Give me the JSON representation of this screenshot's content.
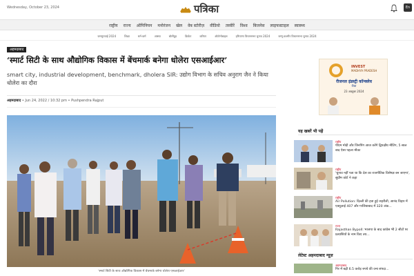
{
  "header": {
    "date": "Wednesday, October 23, 2024",
    "logo": "पत्रिका",
    "lang_label": "En"
  },
  "nav": {
    "items": [
      "राष्ट्रीय",
      "राज्य",
      "ऑपिनियन",
      "मनोरंजन",
      "खेल",
      "वेब स्टोरीज़",
      "वीडियो",
      "तस्वीरें",
      "विश्व",
      "बिजनेस",
      "लाइफस्टाइल",
      "स्वास्थ्य"
    ]
  },
  "subnav": {
    "items": [
      "जनसुनवाई 2024",
      "शिक्षा",
      "धर्म-कर्म",
      "आस्था",
      "बॉलीवुड",
      "क्रिकेट",
      "करियर",
      "ऑटोमोबाइल",
      "हरियाणा विधानसभा चुनाव 2024",
      "जम्मू-कश्मीर विधानसभा चुनाव 2024"
    ]
  },
  "article": {
    "tag": "अहमदाबाद",
    "headline": "‘स्मार्ट सिटी के साथ औद्योगिक विकास में बेंचमार्क बनेगा धोलेरा एसआईआर’",
    "subhead": "smart city, industrial development, benchmark, dholera SIR: उद्योग विभाग के सचिव अनुराग जैन ने किया धोलेरा का दौरा",
    "byline_city": "अहमदाबाद",
    "byline_rest": " • Jun 24, 2022 / 10:32 pm • Pushpendra Rajput",
    "caption": "‘स्मार्ट सिटी के साथ औद्योगिक विकास में बेंचमार्क बनेगा धोलेरा एसआईआर’"
  },
  "ad": {
    "line1": "INVEST",
    "line2": "MADHYA PRADESH",
    "line3": "रीजनल इंडस्ट्री कॉन्क्लेव",
    "line4": "रीवा",
    "line5": "23 अक्टूबर 2024"
  },
  "sidebar": {
    "heading": "यह खबरें भी पढ़ें",
    "heading2": "लेटेस्ट अहमदाबाद न्यूज़",
    "items": [
      {
        "cat": "राष्ट्रीय",
        "title": "पीएम मोदी और जिनपिंग आज करेंगे द्विपक्षीय मीटिंग, 5 साल बाद ऐसा पहला मौका"
      },
      {
        "cat": "राष्ट्रीय",
        "title": "'चुनाव नहीं पता था कि देश का राजनीतिक विशेषज्ञ बन जाएगा', सुप्रीम कोर्ट ने कहा"
      },
      {
        "cat": "राष्ट्रीय",
        "title": "Air Pollution: दिल्ली की हवा हुई जहरीली, आनंद विहार में एक्यूआई 407 और गाजियाबाद में 320 अंक..."
      },
      {
        "cat": "राज्य",
        "title": "Rajasthan Bypoll: भाजपा के बाद कांग्रेस भी 2 सीटों पर प्रत्याशियों के नाम किए तय..."
      }
    ],
    "latest": [
      {
        "cat": "अहमदाबाद",
        "title": "गिर में बढ़ी 6.5 करोड़ रुपये की वन्य संपदा..."
      }
    ]
  }
}
